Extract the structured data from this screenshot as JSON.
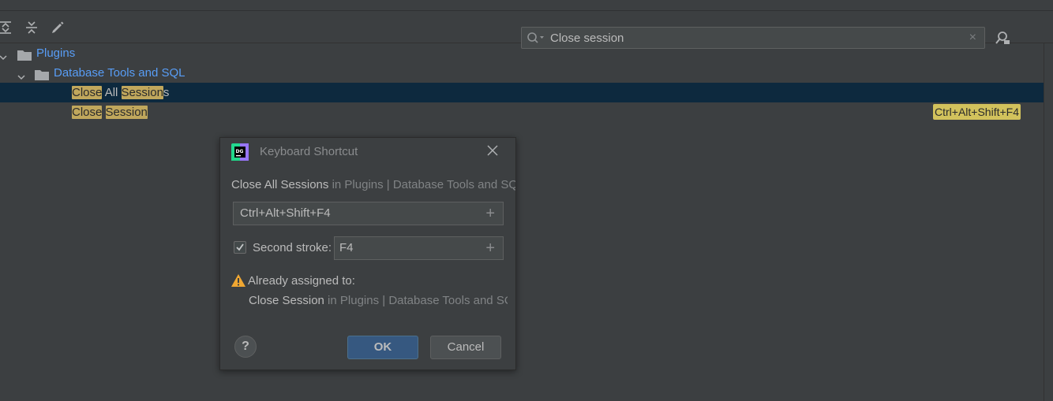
{
  "search": {
    "value": "Close session",
    "clear_glyph": "×"
  },
  "toolbar": {
    "icons": [
      "expand-all-icon",
      "collapse-all-icon",
      "edit-shortcut-icon"
    ]
  },
  "tree": {
    "plugins_label": "Plugins",
    "db_tools_label": "Database Tools and SQL",
    "row_close_all": {
      "part1": "Close",
      "part2": " All ",
      "part3": "Session",
      "part4": "s"
    },
    "row_close_session": {
      "part1": "Close",
      "part2": " ",
      "part3": "Session",
      "shortcut": "Ctrl+Alt+Shift+F4"
    }
  },
  "dialog": {
    "title": "Keyboard Shortcut",
    "action_name": "Close All Sessions",
    "action_path": " in Plugins | Database Tools and SQL",
    "first_stroke": "Ctrl+Alt+Shift+F4",
    "second_stroke_label": "Second stroke:",
    "second_stroke_checked": true,
    "second_stroke": "F4",
    "plus_glyph": "+",
    "warning_label": "Already assigned to:",
    "conflict_name": "Close Session",
    "conflict_path": " in Plugins | Database Tools and SQL",
    "help_glyph": "?",
    "ok_label": "OK",
    "cancel_label": "Cancel"
  },
  "colors": {
    "background": "#3c3f41",
    "selection": "#0d293e",
    "highlight": "#c0a75c",
    "link_blue": "#589df6",
    "ok_button": "#365880",
    "warning": "#f0a732"
  }
}
